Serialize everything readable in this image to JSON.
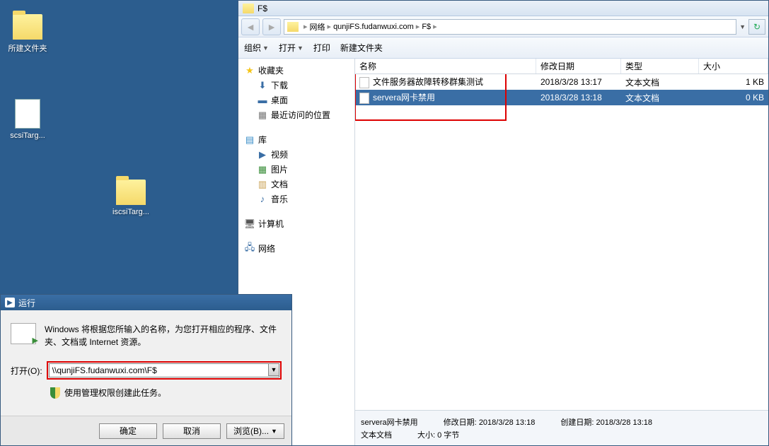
{
  "desktop": {
    "icons": [
      {
        "label": "所建文件夹",
        "type": "folder"
      },
      {
        "label": "scsiTarg...",
        "type": "doc"
      },
      {
        "label": "iscsiTarg...",
        "type": "folder"
      }
    ]
  },
  "explorer": {
    "title": "F$",
    "address": {
      "part1": "网络",
      "part2": "qunjiFS.fudanwuxi.com",
      "part3": "F$"
    },
    "toolbar": {
      "organize": "组织",
      "open": "打开",
      "print": "打印",
      "newfolder": "新建文件夹"
    },
    "sidebar": {
      "favorites": "收藏夹",
      "downloads": "下载",
      "desktop": "桌面",
      "recent": "最近访问的位置",
      "libraries": "库",
      "videos": "视频",
      "pictures": "图片",
      "documents": "文档",
      "music": "音乐",
      "computer": "计算机",
      "network": "网络"
    },
    "columns": {
      "name": "名称",
      "date": "修改日期",
      "type": "类型",
      "size": "大小"
    },
    "files": [
      {
        "name": "文件服务器故障转移群集测试",
        "date": "2018/3/28 13:17",
        "type": "文本文档",
        "size": "1 KB"
      },
      {
        "name": "servera网卡禁用",
        "date": "2018/3/28 13:18",
        "type": "文本文档",
        "size": "0 KB"
      }
    ],
    "status": {
      "name": "servera网卡禁用",
      "mod_label": "修改日期:",
      "mod_value": "2018/3/28 13:18",
      "create_label": "创建日期:",
      "create_value": "2018/3/28 13:18",
      "type": "文本文档",
      "size_label": "大小:",
      "size_value": "0 字节"
    }
  },
  "run": {
    "title": "运行",
    "description": "Windows 将根据您所输入的名称，为您打开相应的程序、文件夹、文档或 Internet 资源。",
    "open_label": "打开(O):",
    "value": "\\\\qunjiFS.fudanwuxi.com\\F$",
    "admin_note": "使用管理权限创建此任务。",
    "ok": "确定",
    "cancel": "取消",
    "browse": "浏览(B)..."
  }
}
